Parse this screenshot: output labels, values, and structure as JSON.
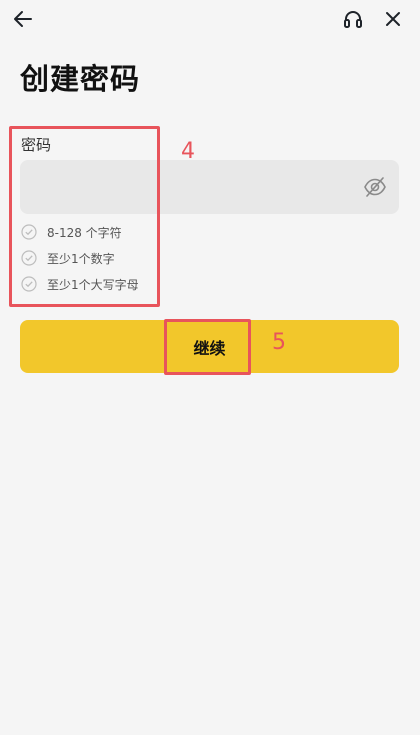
{
  "header": {
    "back_icon": "arrow-left-icon",
    "support_icon": "headset-icon",
    "close_icon": "close-icon"
  },
  "page": {
    "title": "创建密码"
  },
  "password_field": {
    "label": "密码",
    "value": "",
    "placeholder": "",
    "visibility_icon": "eye-off-icon"
  },
  "requirements": [
    {
      "text": "8-128 个字符"
    },
    {
      "text": "至少1个数字"
    },
    {
      "text": "至少1个大写字母"
    }
  ],
  "continue_button": {
    "label": "继续"
  },
  "annotations": {
    "box_4_label": "4",
    "box_5_label": "5",
    "color": "#e8545b"
  },
  "colors": {
    "accent": "#f2c72b",
    "background": "#f5f5f5",
    "input_background": "#e8e8e8"
  }
}
